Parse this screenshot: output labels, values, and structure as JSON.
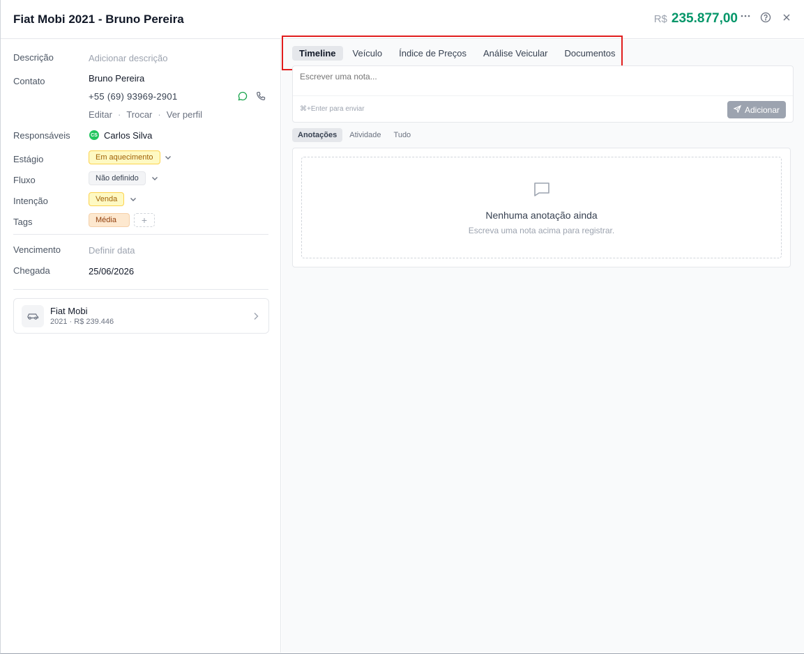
{
  "header": {
    "title": "Fiat Mobi 2021 - Bruno Pereira",
    "currency": "R$",
    "amount": "235.877,00"
  },
  "details": {
    "descricao_label": "Descrição",
    "descricao_placeholder": "Adicionar descrição",
    "contato_label": "Contato",
    "contact_name": "Bruno Pereira",
    "contact_phone": "+55 (69) 93969-2901",
    "contact_actions": [
      "Editar",
      "Trocar",
      "Ver perfil"
    ],
    "responsaveis_label": "Responsáveis",
    "responsavel_initials": "CS",
    "responsavel_name": "Carlos Silva",
    "estagio_label": "Estágio",
    "estagio_value": "Em aquecimento",
    "fluxo_label": "Fluxo",
    "fluxo_value": "Não definido",
    "intencao_label": "Intenção",
    "intencao_value": "Venda",
    "tags_label": "Tags",
    "tag_value": "Média",
    "add_tag_symbol": "+",
    "vencimento_label": "Vencimento",
    "vencimento_placeholder": "Definir data",
    "chegada_label": "Chegada",
    "chegada_value": "25/06/2026"
  },
  "vehicle": {
    "name": "Fiat Mobi",
    "subtitle": "2021 · R$ 239.446"
  },
  "tabs": [
    "Timeline",
    "Veículo",
    "Índice de Preços",
    "Análise Veicular",
    "Documentos"
  ],
  "active_tab": "Timeline",
  "note": {
    "placeholder": "Escrever uma nota...",
    "hint": "⌘+Enter para enviar",
    "add_label": "Adicionar"
  },
  "subtabs": [
    "Anotações",
    "Atividade",
    "Tudo"
  ],
  "active_subtab": "Anotações",
  "empty_state": {
    "title": "Nenhuma anotação ainda",
    "subtitle": "Escreva uma nota acima para registrar."
  },
  "colors": {
    "price": "#059669",
    "highlight": "#e11d1d",
    "whatsapp": "#16a34a"
  },
  "icons": [
    "more-icon",
    "help-icon",
    "close-icon",
    "whatsapp-icon",
    "phone-icon",
    "chevron-down-icon",
    "plus-icon",
    "car-icon",
    "chevron-right-icon",
    "send-icon",
    "chat-bubble-icon"
  ]
}
